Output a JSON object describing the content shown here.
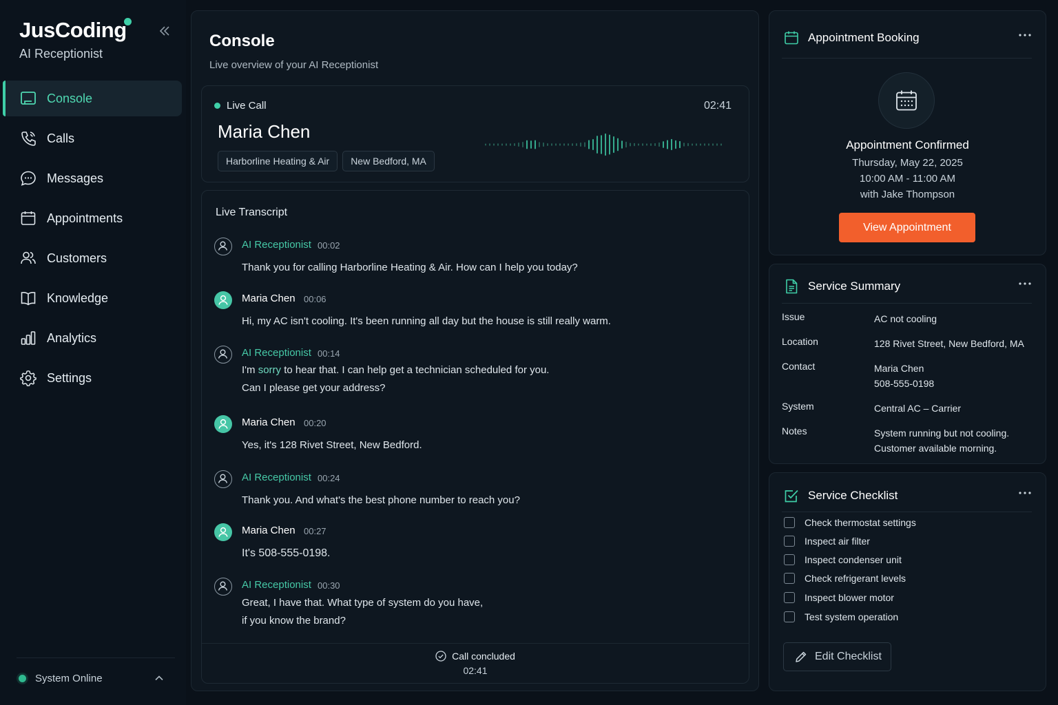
{
  "brand": {
    "name": "JusCoding",
    "subtitle": "AI Receptionist"
  },
  "sidebar": {
    "items": [
      {
        "label": "Console",
        "icon": "console-icon",
        "active": true
      },
      {
        "label": "Calls",
        "icon": "phone-icon"
      },
      {
        "label": "Messages",
        "icon": "message-icon"
      },
      {
        "label": "Appointments",
        "icon": "calendar-icon"
      },
      {
        "label": "Customers",
        "icon": "users-icon"
      },
      {
        "label": "Knowledge",
        "icon": "book-icon"
      },
      {
        "label": "Analytics",
        "icon": "bar-chart-icon"
      },
      {
        "label": "Settings",
        "icon": "gear-icon"
      }
    ],
    "status": "System Online"
  },
  "console": {
    "title": "Console",
    "subtitle": "Live overview of your AI Receptionist"
  },
  "live_call": {
    "label": "Live Call",
    "timer": "02:41",
    "caller": "Maria Chen",
    "tags": [
      "Harborline Heating & Air",
      "New Bedford, MA"
    ]
  },
  "transcript": {
    "title": "Live Transcript",
    "messages": [
      {
        "speaker": "AI Receptionist",
        "role": "ai",
        "time": "00:02",
        "lines": [
          "Thank you for calling Harborline Heating & Air. How can I help you today?"
        ]
      },
      {
        "speaker": "Maria Chen",
        "role": "user",
        "time": "00:06",
        "lines": [
          "Hi, my AC isn't cooling. It's been running all day but the house is still really warm."
        ]
      },
      {
        "speaker": "AI Receptionist",
        "role": "ai",
        "time": "00:14",
        "lines": [
          "I'm sorry to hear that. I can help get a technician scheduled for you.",
          "Can I please get your address?"
        ]
      },
      {
        "speaker": "Maria Chen",
        "role": "user",
        "time": "00:20",
        "lines": [
          "Yes, it's 128 Rivet Street, New Bedford."
        ]
      },
      {
        "speaker": "AI Receptionist",
        "role": "ai",
        "time": "00:24",
        "lines": [
          "Thank you. And what's the best phone number to reach you?"
        ]
      },
      {
        "speaker": "Maria Chen",
        "role": "user",
        "time": "00:27",
        "lines": [
          "It's 508-555-0198."
        ]
      },
      {
        "speaker": "AI Receptionist",
        "role": "ai",
        "time": "00:30",
        "lines": [
          "Great, I have that. What type of system do you have,",
          "if you know the brand?"
        ]
      }
    ],
    "concluded_label": "Call concluded",
    "concluded_time": "02:41"
  },
  "appointment": {
    "title": "Appointment Booking",
    "status": "Appointment Confirmed",
    "date": "Thursday, May 22, 2025",
    "time": "10:00 AM - 11:00 AM",
    "technician": "with Jake Thompson",
    "button": "View Appointment"
  },
  "summary": {
    "title": "Service Summary",
    "rows": [
      {
        "label": "Issue",
        "value": "AC not cooling"
      },
      {
        "label": "Location",
        "value": "128 Rivet Street, New Bedford, MA"
      },
      {
        "label": "Contact",
        "value": "Maria Chen\n508-555-0198"
      },
      {
        "label": "System",
        "value": "Central AC – Carrier"
      },
      {
        "label": "Notes",
        "value": "System running but not cooling.\nCustomer available morning."
      }
    ]
  },
  "checklist": {
    "title": "Service Checklist",
    "items": [
      "Check thermostat settings",
      "Inspect air filter",
      "Inspect condenser unit",
      "Check refrigerant levels",
      "Inspect blower motor",
      "Test system operation"
    ],
    "edit_button": "Edit Checklist"
  },
  "colors": {
    "accent": "#3fcfa8",
    "cta": "#f25f2c",
    "background": "#0a1119"
  }
}
